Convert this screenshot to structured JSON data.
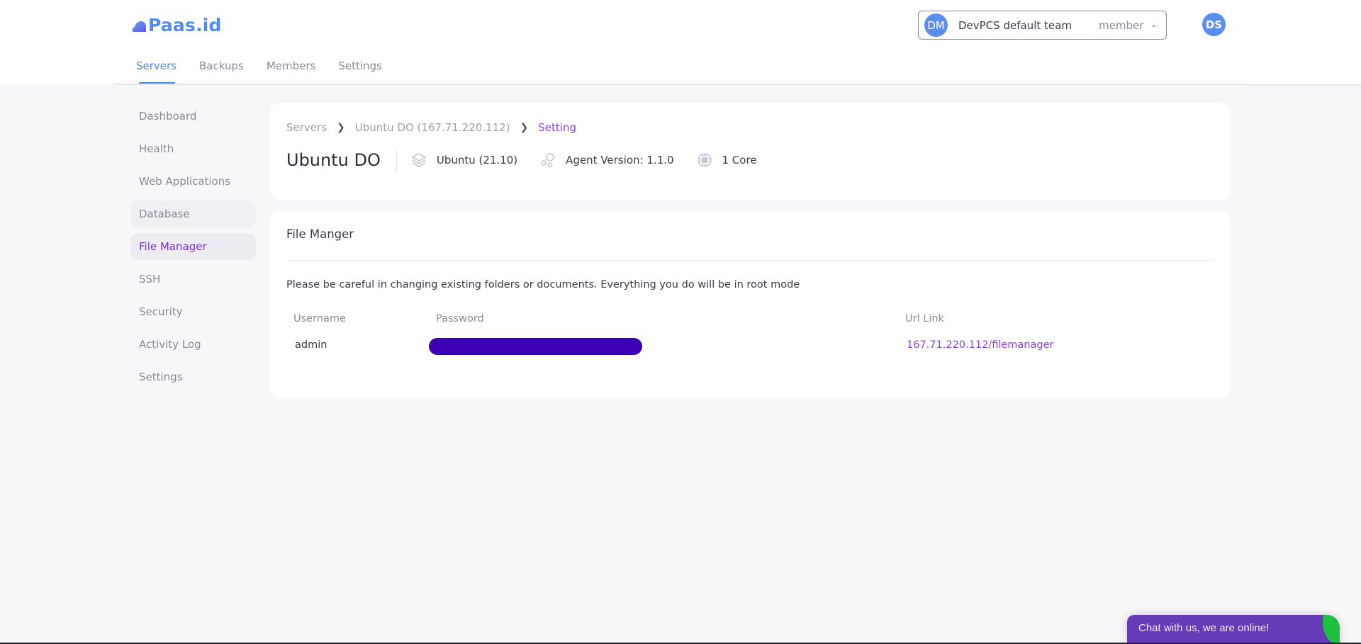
{
  "app": {
    "logo_text": "Paas.id",
    "brand_color": "#4f8df0",
    "accent_color": "#8a3ff0"
  },
  "header": {
    "tabs": [
      {
        "label": "Servers",
        "active": true
      },
      {
        "label": "Backups",
        "active": false
      },
      {
        "label": "Members",
        "active": false
      },
      {
        "label": "Settings",
        "active": false
      }
    ],
    "team_selector": {
      "avatar_initials": "DM",
      "team_name": "DevPCS default team",
      "role": "member",
      "chevron": "chevron-down-icon"
    },
    "user_avatar_initials": "DS"
  },
  "sidebar": {
    "items": [
      {
        "label": "Dashboard",
        "state": "normal"
      },
      {
        "label": "Health",
        "state": "normal"
      },
      {
        "label": "Web Applications",
        "state": "normal"
      },
      {
        "label": "Database",
        "state": "hover"
      },
      {
        "label": "File Manager",
        "state": "active"
      },
      {
        "label": "SSH",
        "state": "normal"
      },
      {
        "label": "Security",
        "state": "normal"
      },
      {
        "label": "Activity Log",
        "state": "normal"
      },
      {
        "label": "Settings",
        "state": "normal"
      }
    ]
  },
  "server_header": {
    "breadcrumb": [
      {
        "label": "Servers"
      },
      {
        "label": "Ubuntu DO (167.71.220.112)"
      },
      {
        "label": "Setting",
        "current": true
      }
    ],
    "server_name": "Ubuntu DO",
    "os": {
      "icon": "layers-icon",
      "label": "Ubuntu (21.10)"
    },
    "agent": {
      "icon": "bubbles-icon",
      "label": "Agent Version: 1.1.0"
    },
    "cpu": {
      "icon": "cpu-chip-icon",
      "label": "1 Core"
    }
  },
  "file_manager": {
    "title": "File Manger",
    "notice": "Please be careful in changing existing folders or documents. Everything you do will be in root mode",
    "columns": {
      "username": "Username",
      "password": "Password",
      "url": "Url Link"
    },
    "row": {
      "username": "admin",
      "password": "[redacted]",
      "url": "167.71.220.112/filemanager"
    }
  },
  "chat_widget": {
    "label": "Chat with us, we are online!",
    "color": "#673ab7",
    "status_color": "#1ec13e"
  }
}
